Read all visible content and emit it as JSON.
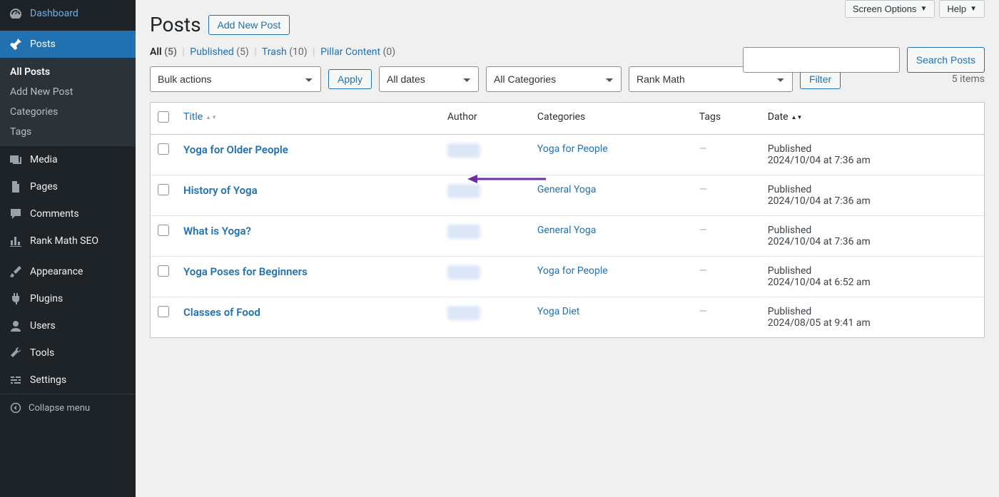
{
  "topright": {
    "screen_options": "Screen Options",
    "help": "Help"
  },
  "sidebar": {
    "dashboard": "Dashboard",
    "posts": "Posts",
    "posts_sub": {
      "all": "All Posts",
      "add": "Add New Post",
      "categories": "Categories",
      "tags": "Tags"
    },
    "media": "Media",
    "pages": "Pages",
    "comments": "Comments",
    "rankmath": "Rank Math SEO",
    "appearance": "Appearance",
    "plugins": "Plugins",
    "users": "Users",
    "tools": "Tools",
    "settings": "Settings",
    "collapse": "Collapse menu"
  },
  "heading": {
    "title": "Posts",
    "add_new": "Add New Post"
  },
  "views": {
    "all_label": "All",
    "all_count": "(5)",
    "published_label": "Published",
    "published_count": "(5)",
    "trash_label": "Trash",
    "trash_count": "(10)",
    "pillar_label": "Pillar Content",
    "pillar_count": "(0)"
  },
  "search": {
    "button": "Search Posts",
    "placeholder": ""
  },
  "filters": {
    "bulk": "Bulk actions",
    "apply": "Apply",
    "dates": "All dates",
    "categories": "All Categories",
    "rankmath": "Rank Math",
    "filter": "Filter"
  },
  "count": "5 items",
  "columns": {
    "title": "Title",
    "author": "Author",
    "categories": "Categories",
    "tags": "Tags",
    "date": "Date"
  },
  "rows": [
    {
      "title": "Yoga for Older People",
      "categories": [
        "Yoga for People"
      ],
      "tags": "—",
      "date_status": "Published",
      "date_line": "2024/10/04 at 7:36 am"
    },
    {
      "title": "History of Yoga",
      "categories": [
        "General Yoga"
      ],
      "tags": "—",
      "date_status": "Published",
      "date_line": "2024/10/04 at 7:36 am"
    },
    {
      "title": "What is Yoga?",
      "categories": [
        "General Yoga"
      ],
      "tags": "—",
      "date_status": "Published",
      "date_line": "2024/10/04 at 7:36 am"
    },
    {
      "title": "Yoga Poses for Beginners",
      "categories": [
        "Yoga for People"
      ],
      "tags": "—",
      "date_status": "Published",
      "date_line": "2024/10/04 at 6:52 am"
    },
    {
      "title": "Classes of Food",
      "categories": [
        "Yoga Diet"
      ],
      "tags": "—",
      "date_status": "Published",
      "date_line": "2024/08/05 at 9:41 am"
    }
  ],
  "colors": {
    "link": "#2271b1",
    "accent": "#6b30a3"
  }
}
